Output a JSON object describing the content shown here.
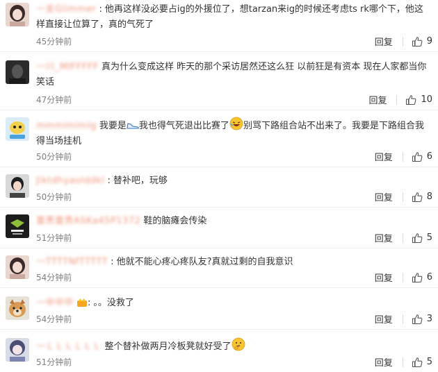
{
  "comments": [
    {
      "user": "一支Glimmer",
      "text": "他再这样没必要占ig的外援位了，想tarzan来ig的时候还考虑ts rk哪个下，他这样直接让位算了，真的气死了",
      "time": "45分钟前",
      "reply": "回复",
      "likes": "9",
      "avatar": "girl-avatar"
    },
    {
      "user": "一川_MIFFFFF",
      "text": "真为什么变成这样 昨天的那个采访居然还这么狂 以前狂是有资本 现在人家都当你笑话",
      "time": "47分钟前",
      "reply": "回复",
      "likes": "10",
      "avatar": "dark-avatar"
    },
    {
      "user": "mmmlmlmlg",
      "text_a": "我要是",
      "text_b": "我也得气死退出比赛了",
      "text_c": "别骂下路组合站不出来了。我要是下路组合我得当场挂机",
      "time": "50分钟前",
      "reply": "回复",
      "likes": "6",
      "avatar": "cartoon-avatar"
    },
    {
      "user": "Jiktdhyaolddkl",
      "text": "替补吧，玩够",
      "time": "50分钟前",
      "reply": "回复",
      "likes": "8",
      "avatar": "person-avatar"
    },
    {
      "user": "富贵富贵ASKa45P1372",
      "text": "鞋的脑瘫会传染",
      "time": "51分钟前",
      "reply": "回复",
      "likes": "5",
      "avatar": "logo-avatar"
    },
    {
      "user": "一TTTTNfTTTTT",
      "text": "他就不能心疼心疼队友?真就过剩的自我意识",
      "time": "54分钟前",
      "reply": "回复",
      "likes": "6",
      "avatar": "girl-avatar"
    },
    {
      "user": "一中中中",
      "text": "。。没救了",
      "time": "54分钟前",
      "reply": "回复",
      "likes": "3",
      "avatar": "dog-avatar"
    },
    {
      "user": "一ＬＬＬＬＬＬ",
      "text": "整个替补做两月冷板凳就好受了",
      "time": "51分钟前",
      "reply": "回复",
      "likes": "5",
      "avatar": "anime-avatar"
    }
  ],
  "colors": {
    "username": "#eb7350",
    "meta": "#808080",
    "divider": "#eeeeee"
  }
}
